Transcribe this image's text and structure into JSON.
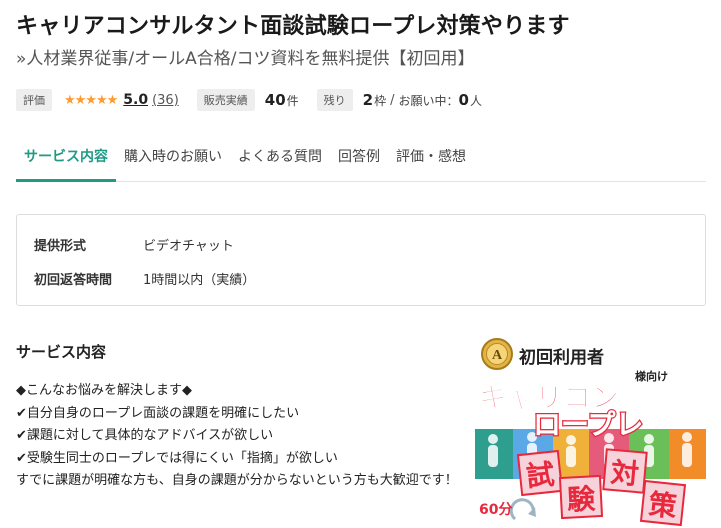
{
  "title": "キャリアコンサルタント面談試験ロープレ対策やります",
  "subtitle": "»人材業界従事/オールA合格/コツ資料を無料提供【初回用】",
  "stats": {
    "rating_label": "評価",
    "stars": "★★★★★",
    "rating": "5.0",
    "review_count": "(36)",
    "sales_label": "販売実績",
    "sales_value": "40",
    "sales_unit": "件",
    "remaining_label": "残り",
    "remaining_value": "2",
    "remaining_unit": "枠",
    "slash": "/",
    "in_progress_label": "お願い中：",
    "in_progress_value": "0",
    "in_progress_unit": "人"
  },
  "tabs": [
    {
      "label": "サービス内容",
      "active": true
    },
    {
      "label": "購入時のお願い",
      "active": false
    },
    {
      "label": "よくある質問",
      "active": false
    },
    {
      "label": "回答例",
      "active": false
    },
    {
      "label": "評価・感想",
      "active": false
    }
  ],
  "info": [
    {
      "key": "提供形式",
      "value": "ビデオチャット"
    },
    {
      "key": "初回返答時間",
      "value": "1時間以内（実績）"
    }
  ],
  "section_title": "サービス内容",
  "description": [
    "◆こんなお悩みを解決します◆",
    "✔自分自身のロープレ面談の課題を明確にしたい",
    "✔課題に対して具体的なアドバイスが欲しい",
    "✔受験生同士のロープレでは得にくい「指摘」が欲しい",
    "すでに課題が明確な方も、自身の課題が分からないという方も大歓迎です！"
  ],
  "banner": {
    "badge_letter": "A",
    "top_text": "初回利用者",
    "top_suffix": "様向け",
    "line1": "キャリコン",
    "line2": "ロープレ",
    "stamp_chars": [
      "試",
      "対",
      "験",
      "策"
    ],
    "minutes": "60分",
    "colors": {
      "red": "#e8283c",
      "stamp_bg": "#f6d3da",
      "gold": "#c79a2b"
    }
  },
  "colors": {
    "accent": "#1e9a85",
    "star": "#ff9a2e"
  }
}
